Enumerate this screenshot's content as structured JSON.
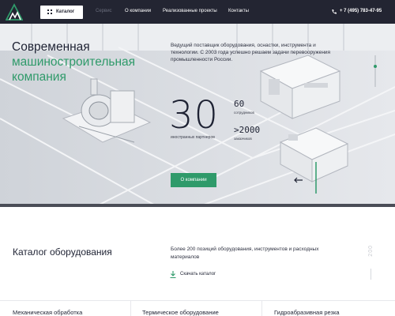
{
  "header": {
    "catalog_button": "Каталог",
    "nav": [
      "Сервис",
      "О компании",
      "Реализованные проекты",
      "Контакты"
    ],
    "phone": "+ 7 (495) 783-47-95",
    "colors": {
      "bg": "#232532",
      "muted": "#6a6d7c"
    }
  },
  "hero": {
    "title_line1": "Современная",
    "title_line2": "машиностроительная",
    "title_line3": "компания",
    "description": "Ведущий поставщик оборудования, оснастки, инструмента и технологии. С 2003 года успешно решаем задачи перевооружения промышленности России.",
    "big_number": "30",
    "big_number_label": "иностранных партнеров",
    "stats": [
      {
        "value": "60",
        "label": "сотрудников"
      },
      {
        "value": ">2000",
        "label": "заказчиков"
      }
    ],
    "about_button": "О компании",
    "accent": "#2f9a6a"
  },
  "catalog": {
    "title": "Каталог оборудования",
    "description": "Более 200 позиций оборудования, инструментов и расходных материалов",
    "download_link": "Скачать каталог",
    "vertical_number": "200",
    "categories": [
      "Механическая обработка",
      "Термическое оборудование",
      "Гидроабразивная резка"
    ]
  }
}
